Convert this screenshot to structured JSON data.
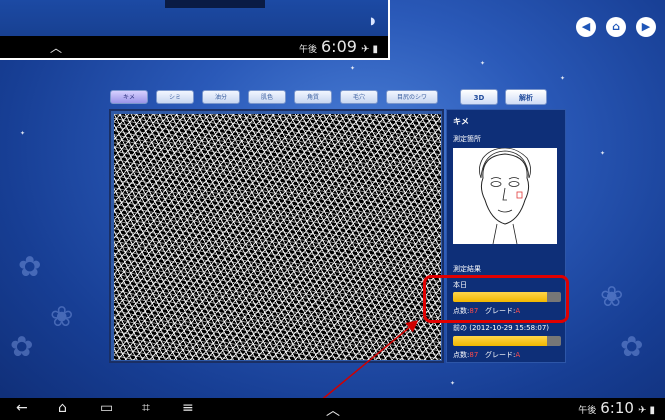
{
  "inset": {
    "time": "6:09",
    "ampm": "午後",
    "status_icons": "✈ ▮",
    "nav_chevron": "︿"
  },
  "nav_buttons": [
    {
      "icon": "back-circle-icon",
      "glyph": "◀"
    },
    {
      "icon": "home-circle-icon",
      "glyph": "⌂"
    },
    {
      "icon": "forward-circle-icon",
      "glyph": "▶"
    }
  ],
  "tabs": [
    {
      "label": "キメ",
      "active": true
    },
    {
      "label": "シミ"
    },
    {
      "label": "油分"
    },
    {
      "label": "肌色"
    },
    {
      "label": "角質"
    },
    {
      "label": "毛穴"
    },
    {
      "label": "目尻のシワ"
    }
  ],
  "actions": {
    "view3d": "3D",
    "analyze": "解析"
  },
  "panel": {
    "title": "キメ",
    "measure_site": "測定箇所",
    "results": "測定結果",
    "today": {
      "label": "本日",
      "score_label": "点数:",
      "score_value": "87",
      "grade_label": "グレード:",
      "grade_value": "A",
      "progress": 0.87
    },
    "previous": {
      "label": "前の (2012-10-29 15:58:07)",
      "score_label": "点数:",
      "score_value": "87",
      "grade_label": "グレード:",
      "grade_value": "A",
      "progress": 0.87
    }
  },
  "android": {
    "time": "6:10",
    "ampm": "午後",
    "status_icons": "✈ ▮",
    "up_chevron": "︿"
  },
  "colors": {
    "accent_blue": "#1f56b8",
    "bar_yellow": "#f2b700",
    "highlight_red": "#e00000",
    "arrow_red": "#d00000"
  }
}
